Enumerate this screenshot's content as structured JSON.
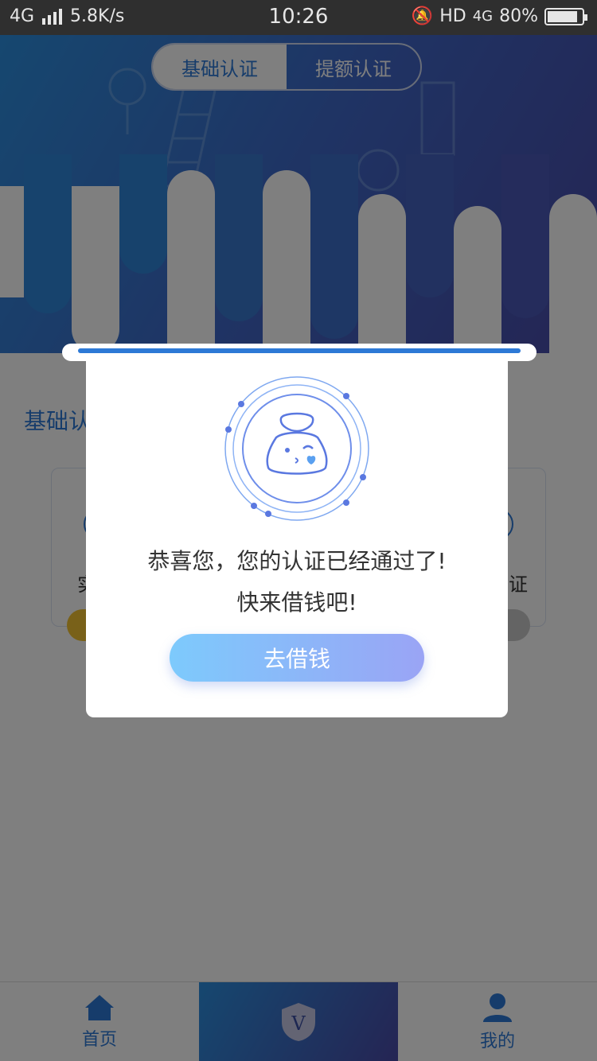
{
  "status_bar": {
    "network": "4G",
    "speed": "5.8K/s",
    "time": "10:26",
    "hd": "HD",
    "net2": "4G",
    "battery": "80%"
  },
  "tabs": [
    {
      "label": "基础认证",
      "active": true
    },
    {
      "label": "提额认证",
      "active": false
    }
  ],
  "content": {
    "section_title": "基础认",
    "card_left_text": "实",
    "card_right_text": "证"
  },
  "modal": {
    "message_line1": "恭喜您，您的认证已经通过了!",
    "message_line2": "快来借钱吧!",
    "button_label": "去借钱"
  },
  "bottom_nav": {
    "home": "首页",
    "mine": "我的"
  },
  "colors": {
    "primary": "#2d79d6",
    "header_start": "#2c8fe0",
    "header_end": "#4a4aa8"
  }
}
